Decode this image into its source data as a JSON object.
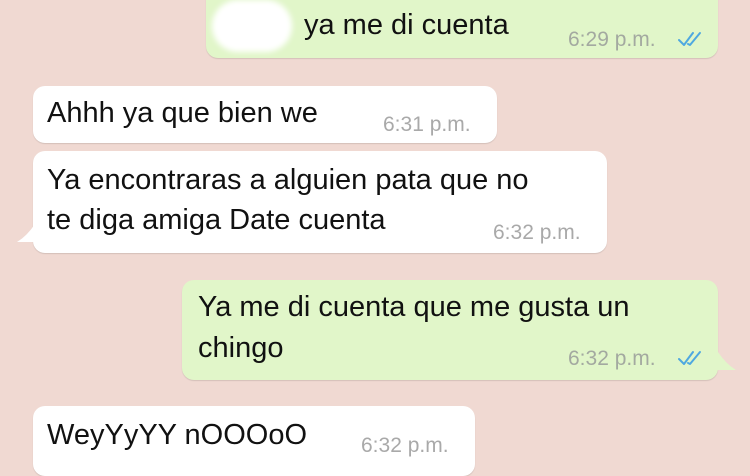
{
  "messages": [
    {
      "direction": "outgoing",
      "lines": [
        "ya me di cuenta"
      ],
      "time": "6:29 p.m.",
      "status": "read"
    },
    {
      "direction": "incoming",
      "lines": [
        "Ahhh ya que bien we"
      ],
      "time": "6:31 p.m."
    },
    {
      "direction": "incoming",
      "lines": [
        "Ya encontraras a alguien pata que no",
        "te diga amiga Date cuenta"
      ],
      "time": "6:32 p.m."
    },
    {
      "direction": "outgoing",
      "lines": [
        "Ya me di cuenta que me gusta un",
        "chingo"
      ],
      "time": "6:32 p.m.",
      "status": "read"
    },
    {
      "direction": "incoming",
      "lines": [
        "WeyYyYY nOOOoO"
      ],
      "time": "6:32 p.m."
    }
  ],
  "colors": {
    "background": "#f0d9d2",
    "outgoing_bubble": "#e1f6c9",
    "incoming_bubble": "#ffffff",
    "read_ticks": "#4fa8e0"
  },
  "icons": {
    "read_receipt": "double-check-icon"
  }
}
